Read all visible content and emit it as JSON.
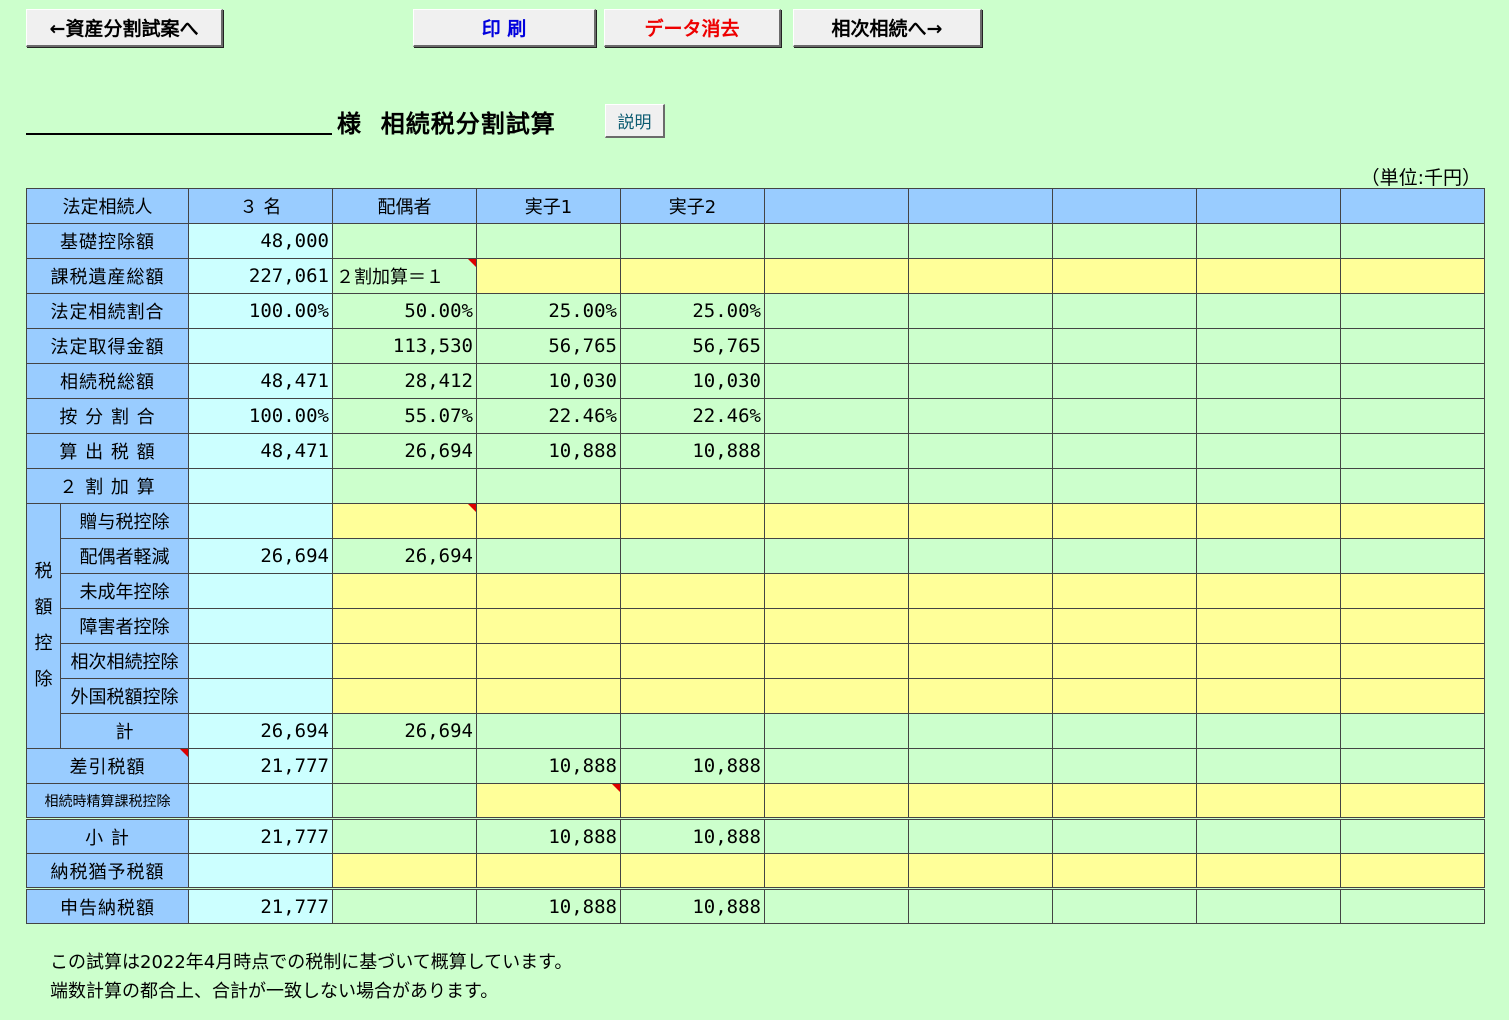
{
  "toolbar": {
    "back_label": "←資産分割試案へ",
    "print_label": "印 刷",
    "clear_label": "データ消去",
    "next_label": "相次相続へ→"
  },
  "header": {
    "title": "様  相続税分割試算",
    "explain_label": "説明",
    "unit": "（単位:千円）"
  },
  "table": {
    "header_label": "法定相続人",
    "heirs_count": "３ 名",
    "columns": [
      "配偶者",
      "実子1",
      "実子2",
      "",
      "",
      "",
      "",
      ""
    ],
    "tax_credit_group_label": "税額控除",
    "rows": [
      {
        "key": "basic",
        "label": "基礎控除額",
        "total": "48,000",
        "values": [
          "",
          "",
          "",
          "",
          "",
          "",
          "",
          ""
        ]
      },
      {
        "key": "taxable",
        "label": "課税遺産総額",
        "total": "227,061",
        "values": [
          "２割加算＝１",
          "",
          "",
          "",
          "",
          "",
          "",
          ""
        ]
      },
      {
        "key": "legal_ratio",
        "label": "法定相続割合",
        "total": "100.00%",
        "values": [
          "50.00%",
          "25.00%",
          "25.00%",
          "",
          "",
          "",
          "",
          ""
        ]
      },
      {
        "key": "legal_amount",
        "label": "法定取得金額",
        "total": "",
        "values": [
          "113,530",
          "56,765",
          "56,765",
          "",
          "",
          "",
          "",
          ""
        ]
      },
      {
        "key": "tax_total",
        "label": "相続税総額",
        "total": "48,471",
        "values": [
          "28,412",
          "10,030",
          "10,030",
          "",
          "",
          "",
          "",
          ""
        ]
      },
      {
        "key": "alloc_ratio",
        "label": "按 分 割 合",
        "total": "100.00%",
        "values": [
          "55.07%",
          "22.46%",
          "22.46%",
          "",
          "",
          "",
          "",
          ""
        ]
      },
      {
        "key": "computed_tax",
        "label": "算 出 税 額",
        "total": "48,471",
        "values": [
          "26,694",
          "10,888",
          "10,888",
          "",
          "",
          "",
          "",
          ""
        ]
      },
      {
        "key": "surcharge",
        "label": "２ 割 加 算",
        "total": "",
        "values": [
          "",
          "",
          "",
          "",
          "",
          "",
          "",
          ""
        ]
      },
      {
        "key": "gift_credit",
        "label": "贈与税控除",
        "total": "",
        "values": [
          "",
          "",
          "",
          "",
          "",
          "",
          "",
          ""
        ]
      },
      {
        "key": "spouse_credit",
        "label": "配偶者軽減",
        "total": "26,694",
        "values": [
          "26,694",
          "",
          "",
          "",
          "",
          "",
          "",
          ""
        ]
      },
      {
        "key": "minor_credit",
        "label": "未成年控除",
        "total": "",
        "values": [
          "",
          "",
          "",
          "",
          "",
          "",
          "",
          ""
        ]
      },
      {
        "key": "disabled_credit",
        "label": "障害者控除",
        "total": "",
        "values": [
          "",
          "",
          "",
          "",
          "",
          "",
          "",
          ""
        ]
      },
      {
        "key": "successive_credit",
        "label": "相次相続控除",
        "total": "",
        "values": [
          "",
          "",
          "",
          "",
          "",
          "",
          "",
          ""
        ]
      },
      {
        "key": "foreign_credit",
        "label": "外国税額控除",
        "total": "",
        "values": [
          "",
          "",
          "",
          "",
          "",
          "",
          "",
          ""
        ]
      },
      {
        "key": "credit_sum",
        "label": "計",
        "total": "26,694",
        "values": [
          "26,694",
          "",
          "",
          "",
          "",
          "",
          "",
          ""
        ]
      },
      {
        "key": "net_tax",
        "label": "差引税額",
        "total": "21,777",
        "values": [
          "",
          "10,888",
          "10,888",
          "",
          "",
          "",
          "",
          ""
        ]
      },
      {
        "key": "settlement_credit",
        "label": "相続時精算課税控除",
        "total": "",
        "values": [
          "",
          "",
          "",
          "",
          "",
          "",
          "",
          ""
        ]
      },
      {
        "key": "subtotal",
        "label": "小 計",
        "total": "21,777",
        "values": [
          "",
          "10,888",
          "10,888",
          "",
          "",
          "",
          "",
          ""
        ]
      },
      {
        "key": "deferred",
        "label": "納税猶予税額",
        "total": "",
        "values": [
          "",
          "",
          "",
          "",
          "",
          "",
          "",
          ""
        ]
      },
      {
        "key": "payable",
        "label": "申告納税額",
        "total": "21,777",
        "values": [
          "",
          "10,888",
          "10,888",
          "",
          "",
          "",
          "",
          ""
        ]
      }
    ]
  },
  "footnotes": [
    "この試算は2022年4月時点での税制に基づいて概算しています。",
    "端数計算の都合上、合計が一致しない場合があります。"
  ]
}
